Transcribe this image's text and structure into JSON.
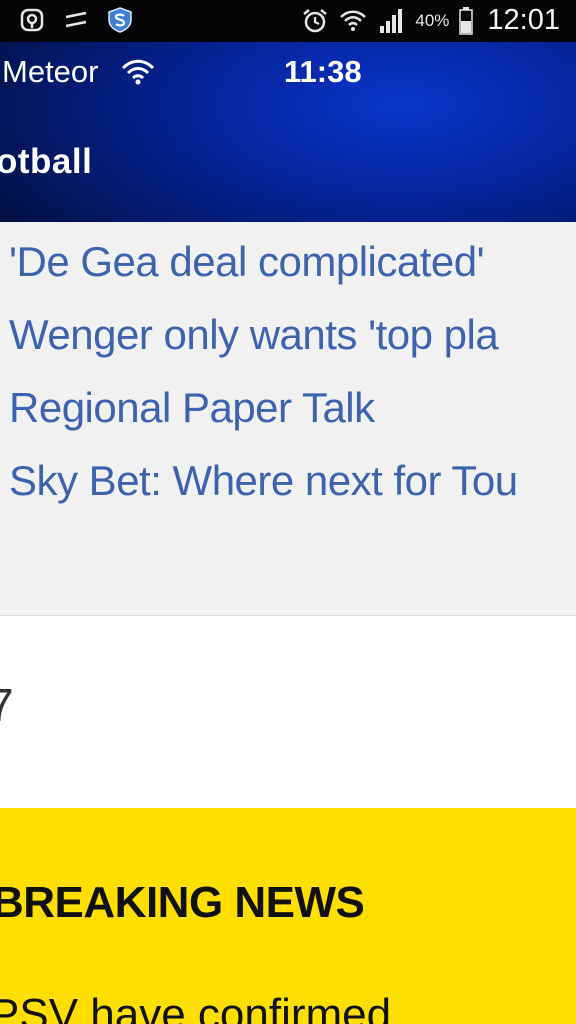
{
  "android_status": {
    "battery_percent": "40%",
    "time": "12:01",
    "icons": [
      "pinned-app-icon",
      "notification-dash-icon",
      "shield-app-icon",
      "alarm-icon",
      "wifi-icon",
      "signal-icon",
      "battery-icon"
    ]
  },
  "ios_status": {
    "carrier": "Meteor",
    "time": "11:38",
    "icons": [
      "wifi-icon"
    ]
  },
  "header": {
    "section_title": "otball"
  },
  "headlines": [
    {
      "text": "'De Gea deal complicated'"
    },
    {
      "text": "Wenger only wants 'top pla"
    },
    {
      "text": "Regional Paper Talk"
    },
    {
      "text": "Sky Bet: Where next for Tou"
    }
  ],
  "count_band": {
    "value": "7"
  },
  "breaking": {
    "label": "BREAKING NEWS",
    "text": "PSV have confirmed"
  },
  "colors": {
    "header_blue": "#0625a0",
    "headline_blue": "#3e62ae",
    "breaking_yellow": "#ffdf00",
    "list_background": "#f1f1f1"
  }
}
